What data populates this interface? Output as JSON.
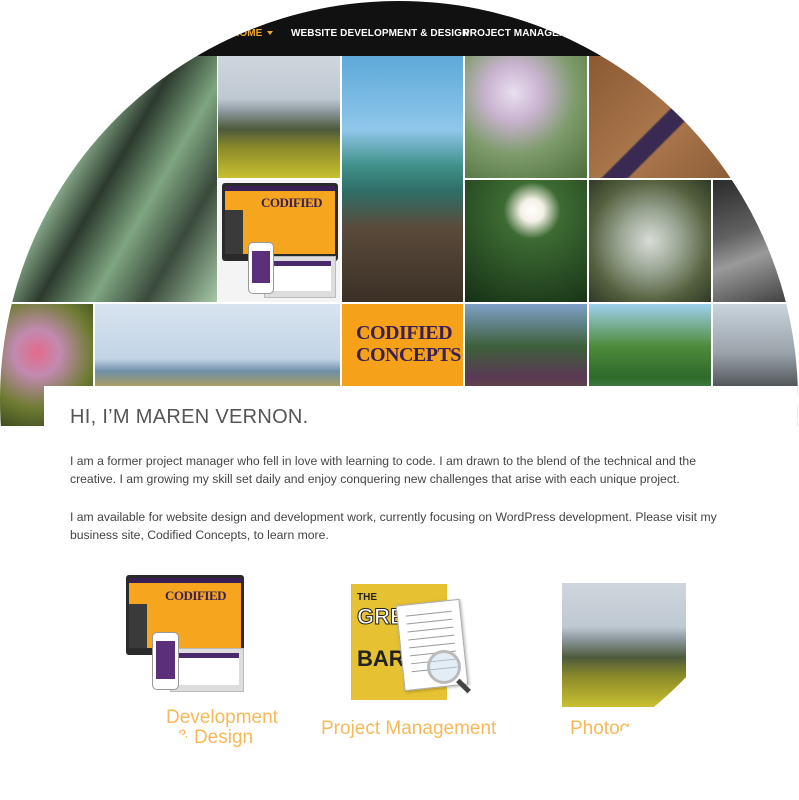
{
  "nav": {
    "items": [
      {
        "label": "HOME",
        "active": true
      },
      {
        "label": "WEBSITE DEVELOPMENT & DESIGN",
        "active": false
      },
      {
        "label": "PROJECT MANAGEMENT",
        "active": false
      }
    ]
  },
  "collage": {
    "mockup_logo_top": "CODIFIED",
    "mockup_logo_bottom": "CONCEPTS"
  },
  "intro": {
    "title": "HI, I’M MAREN VERNON.",
    "paragraph1": "I am a former project manager who fell in love with learning to code. I am drawn to the blend of the technical and the creative. I am growing my skill set daily and enjoy conquering new challenges that arise with each unique project.",
    "paragraph2": "I am available for website design and development work, currently focusing on WordPress development. Please visit my business site, Codified Concepts, to learn more."
  },
  "services": {
    "development": {
      "label_line1": "Development",
      "label_line2": "& Design"
    },
    "project_management": {
      "label": "Project Management",
      "poster_text1": "THE",
      "poster_text2": "GREAT",
      "poster_text3": "BAR"
    },
    "photography": {
      "label": "Photography"
    }
  },
  "colors": {
    "nav_bg": "#111111",
    "accent": "#f0a830",
    "service_label": "#f5b95a",
    "text": "#444444"
  }
}
